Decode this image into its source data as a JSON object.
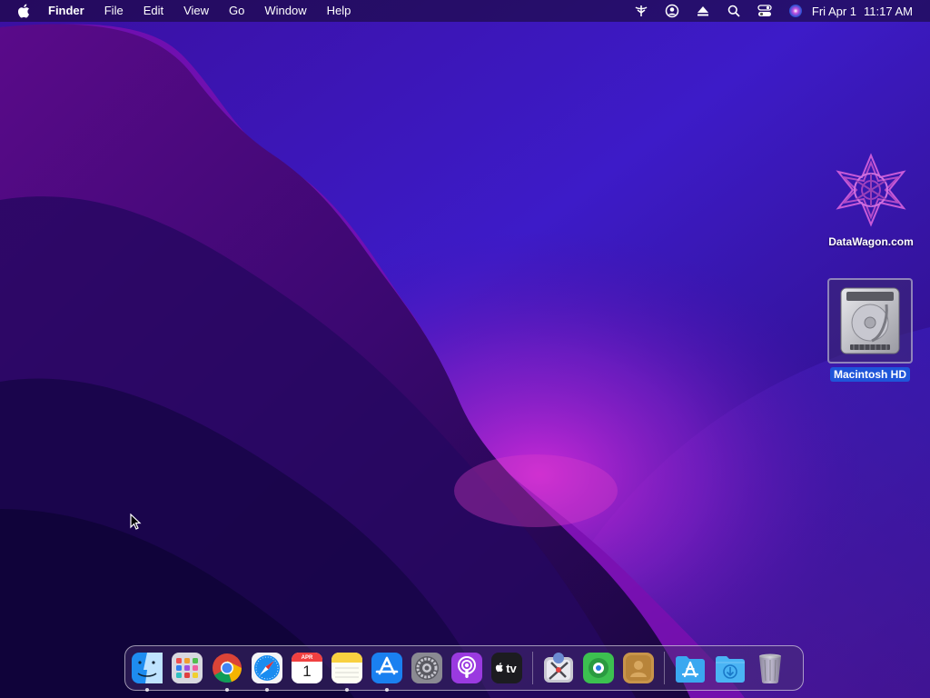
{
  "menubar": {
    "app_name": "Finder",
    "menus": [
      "File",
      "Edit",
      "View",
      "Go",
      "Window",
      "Help"
    ],
    "status_icons": [
      "network-icon",
      "user-account-icon",
      "eject-icon",
      "spotlight-search-icon",
      "control-center-icon",
      "siri-icon"
    ],
    "date": "Fri Apr 1",
    "time": "11:17 AM"
  },
  "desktop_icons": [
    {
      "label": "DataWagon.com",
      "icon": "datawagon-logo-icon",
      "selected": false
    },
    {
      "label": "Macintosh HD",
      "icon": "hard-drive-icon",
      "selected": true
    }
  ],
  "dock": {
    "apps": [
      {
        "name": "Finder",
        "icon": "finder-icon",
        "running": true
      },
      {
        "name": "Launchpad",
        "icon": "launchpad-icon",
        "running": false
      },
      {
        "name": "Google Chrome",
        "icon": "chrome-icon",
        "running": true
      },
      {
        "name": "Safari",
        "icon": "safari-icon",
        "running": true
      },
      {
        "name": "Calendar",
        "icon": "calendar-icon",
        "running": false,
        "month": "APR",
        "day": "1"
      },
      {
        "name": "Notes",
        "icon": "notes-icon",
        "running": true
      },
      {
        "name": "App Store",
        "icon": "app-store-icon",
        "running": true
      },
      {
        "name": "System Preferences",
        "icon": "system-preferences-icon",
        "running": false
      },
      {
        "name": "Podcasts",
        "icon": "podcasts-icon",
        "running": false
      },
      {
        "name": "TV",
        "icon": "apple-tv-icon",
        "running": false,
        "text": "tv"
      },
      {
        "name": "Directory Utility",
        "icon": "directory-utility-icon",
        "running": false
      },
      {
        "name": "Find My",
        "icon": "find-my-icon",
        "running": false
      },
      {
        "name": "Contacts",
        "icon": "contacts-icon",
        "running": false
      }
    ],
    "extras": [
      {
        "name": "Applications",
        "icon": "applications-folder-icon"
      },
      {
        "name": "Downloads",
        "icon": "downloads-folder-icon"
      },
      {
        "name": "Trash",
        "icon": "trash-icon"
      }
    ]
  },
  "colors": {
    "selection_blue": "#1f55d9",
    "wallpaper_dark": "#1e0a58",
    "wallpaper_magenta": "#b01fd0"
  }
}
